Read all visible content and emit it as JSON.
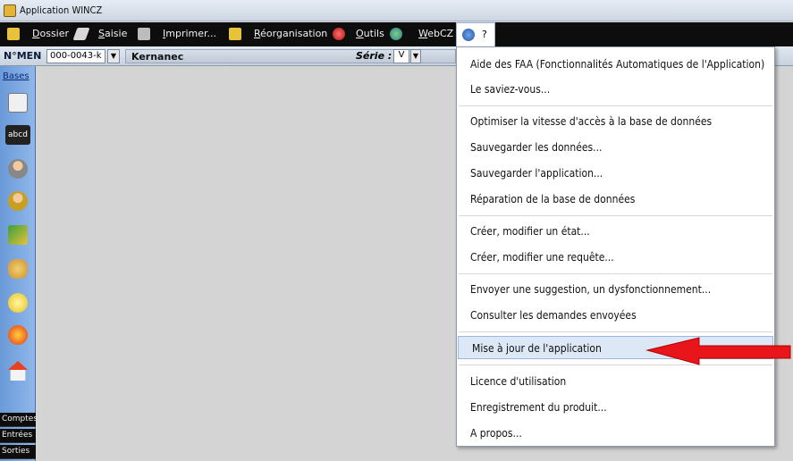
{
  "window": {
    "title": "Application WINCZ"
  },
  "menubar": {
    "items": [
      {
        "label": "Dossier",
        "icon": "folder-icon"
      },
      {
        "label": "Saisie",
        "icon": "pen-icon"
      },
      {
        "label": "Imprimer...",
        "icon": "printer-icon"
      },
      {
        "label": "Réorganisation",
        "icon": "wrench-icon"
      },
      {
        "label": "Outils",
        "icon": "tools-icon"
      },
      {
        "label": "WebCZ",
        "icon": "globe-icon"
      }
    ],
    "help_label": "?"
  },
  "record_bar": {
    "number_label": "N°MEN",
    "number_value": "000-0043-k",
    "name": "Kernanec",
    "serie_label": "Série :",
    "serie_value": "V"
  },
  "sidebar": {
    "top_label": "Bases",
    "icons": [
      "calculator-icon",
      "abcd-icon",
      "person-icon",
      "person-card-icon",
      "stairs-icon",
      "group-icon",
      "lightbulb-icon",
      "fire-icon",
      "house-icon"
    ],
    "abcd_text": "abcd",
    "bottom_items": [
      "Comptes",
      "Entrées",
      "Sorties"
    ]
  },
  "help_menu": {
    "groups": [
      [
        "Aide des FAA (Fonctionnalités Automatiques de l'Application)",
        "Le saviez-vous..."
      ],
      [
        "Optimiser la vitesse d'accès à la base de données",
        "Sauvegarder les données...",
        "Sauvegarder l'application...",
        "Réparation de la base de données"
      ],
      [
        "Créer, modifier un état...",
        "Créer, modifier une requête..."
      ],
      [
        "Envoyer une suggestion, un dysfonctionnement...",
        "Consulter les demandes envoyées"
      ],
      [
        "Mise à jour de l'application"
      ],
      [
        "Licence d'utilisation",
        "Enregistrement du produit...",
        "A propos..."
      ]
    ],
    "highlighted": "Mise à jour de l'application"
  },
  "colors": {
    "menubar": "#0d0d0d",
    "sidebar": "#7ea8e0",
    "highlight": "#dde8f6",
    "arrow": "#e8161b"
  }
}
